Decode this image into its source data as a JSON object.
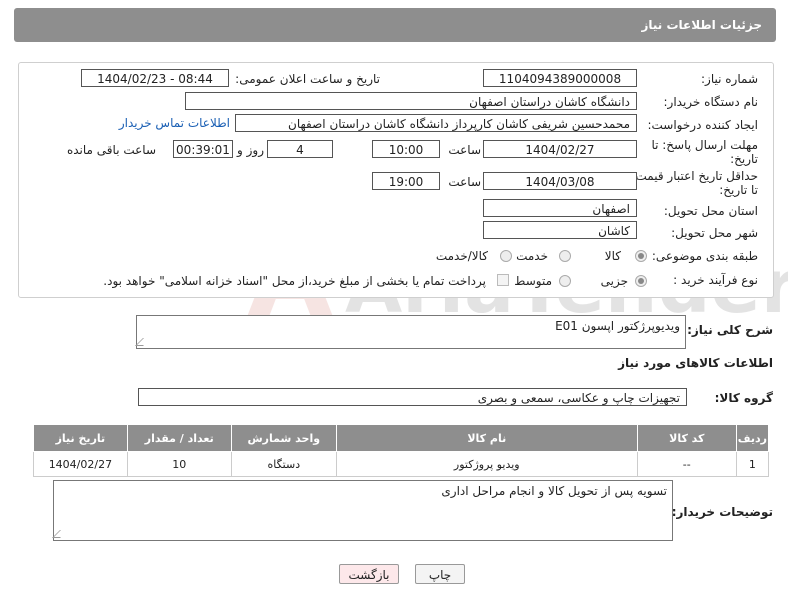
{
  "header": {
    "title": "جزئیات اطلاعات نیاز"
  },
  "fields": {
    "need_number_label": "شماره نیاز:",
    "need_number": "1104094389000008",
    "announce_label": "تاریخ و ساعت اعلان عمومی:",
    "announce_value": "1404/02/23 - 08:44",
    "buyer_org_label": "نام دستگاه خریدار:",
    "buyer_org": "دانشگاه کاشان دراستان اصفهان",
    "creator_label": "ایجاد کننده درخواست:",
    "creator": "محمدحسین شریفی کاشان کارپرداز دانشگاه کاشان دراستان اصفهان",
    "contact_link": "اطلاعات تماس خریدار",
    "deadline_label_1": "مهلت ارسال پاسخ: تا",
    "deadline_label_2": "تاریخ:",
    "deadline_date": "1404/02/27",
    "time_label": "ساعت",
    "deadline_time": "10:00",
    "days_value": "4",
    "days_label": "روز و",
    "remaining_value": "00:39:01",
    "remaining_label": "ساعت باقی مانده",
    "validity_label_1": "حداقل تاریخ اعتبار قیمت:",
    "validity_label_2": "تا تاریخ:",
    "validity_date": "1404/03/08",
    "validity_time": "19:00",
    "province_label": "استان محل تحویل:",
    "province": "اصفهان",
    "city_label": "شهر محل تحویل:",
    "city": "کاشان",
    "category_label": "طبقه بندی موضوعی:",
    "category_options": [
      "کالا",
      "خدمت",
      "کالا/خدمت"
    ],
    "category_selected": "کالا",
    "process_label": "نوع فرآیند خرید :",
    "process_options": [
      "جزیی",
      "متوسط"
    ],
    "process_selected": "جزیی",
    "payment_note": "پرداخت تمام یا بخشی از مبلغ خرید،از محل \"اسناد خزانه اسلامی\" خواهد بود."
  },
  "description": {
    "label": "شرح کلی نیاز:",
    "value": "ویدیوپرژکتور اپسون E01"
  },
  "goods": {
    "section_title": "اطلاعات کالاهای مورد نیاز",
    "group_label": "گروه کالا:",
    "group_value": "تجهیزات چاپ و عکاسی، سمعی و بصری",
    "columns": [
      "ردیف",
      "کد کالا",
      "نام کالا",
      "واحد شمارش",
      "تعداد / مقدار",
      "تاریخ نیاز"
    ],
    "rows": [
      [
        "1",
        "--",
        "ویدیو پروژکتور",
        "دستگاه",
        "10",
        "1404/02/27"
      ]
    ]
  },
  "buyer_notes": {
    "label": "توضیحات خریدار:",
    "value": "تسویه پس از تحویل کالا و انجام مراحل اداری"
  },
  "buttons": {
    "print": "چاپ",
    "back": "بازگشت"
  },
  "watermark": {
    "text": "AriaTender.neT"
  },
  "colors": {
    "header_bg": "#8e8e8e",
    "link": "#1a5fb4",
    "back_bg": "#fde8ea"
  }
}
